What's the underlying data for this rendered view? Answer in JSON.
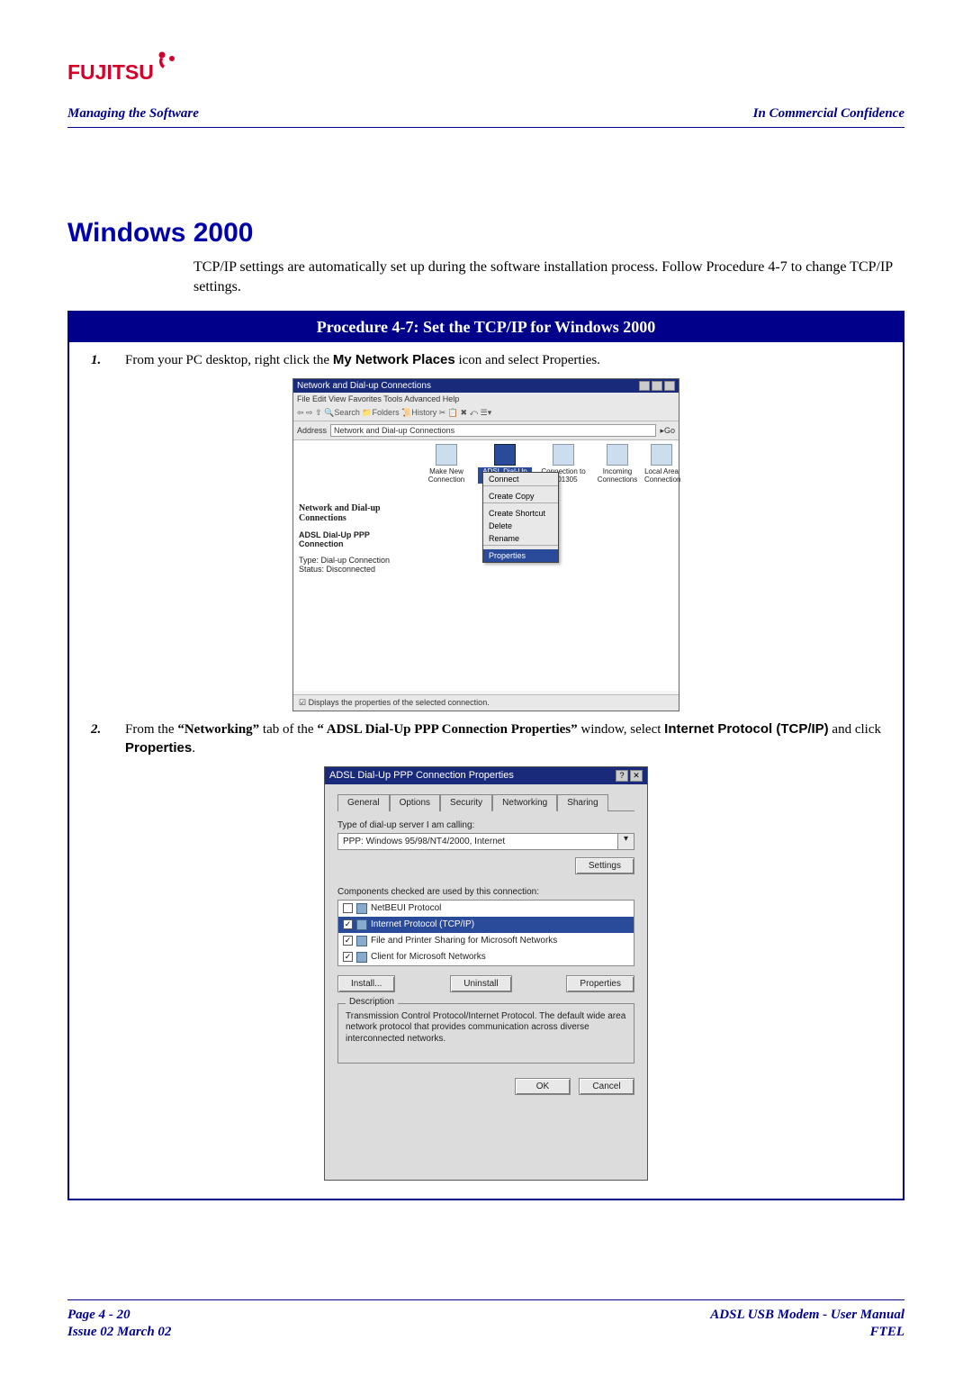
{
  "brand": "FUJITSU",
  "header": {
    "left": "Managing the Software",
    "right": "In Commercial Confidence"
  },
  "section_title": "Windows 2000",
  "intro": "TCP/IP settings are automatically set up during the software installation process. Follow Procedure 4-7 to change TCP/IP settings.",
  "procedure": {
    "title": "Procedure 4-7: Set the TCP/IP for Windows 2000",
    "steps": {
      "s1": {
        "num": "1.",
        "pre": "From your PC desktop, right click the ",
        "bold1": "My Network Places",
        "post": " icon and select Properties."
      },
      "s2": {
        "num": "2.",
        "t1": "From the ",
        "q1": "“Networking”",
        "t2": " tab of the ",
        "q2": "“ ADSL Dial-Up PPP Connection Properties”",
        "t3": " window, select ",
        "b1": "Internet Protocol (TCP/IP)",
        "t4": " and click ",
        "b2": "Properties",
        "t5": "."
      }
    }
  },
  "shot1": {
    "title": "Network and Dial-up Connections",
    "menus": "File  Edit  View  Favorites  Tools  Advanced  Help",
    "toolbar": "⇦  ⇨  ⇧  🔍Search  📁Folders  📜History  ✂ 📋 ✖ ⤺  ☰▾",
    "addr_label": "Address",
    "addr_value": "Network and Dial-up Connections",
    "left_heading": "Network and Dial-up Connections",
    "left_item": "ADSL Dial-Up PPP Connection",
    "left_line1": "Type: Dial-up Connection",
    "left_line2": "Status: Disconnected",
    "icons": {
      "0": "Make New Connection",
      "1": "ADSL Dial-Up PPP Connect",
      "2": "Connection to 3001305",
      "3": "Incoming Connections",
      "4": "Local Area Connection"
    },
    "ctx": {
      "0": "Connect",
      "1": "Create Copy",
      "2": "Create Shortcut",
      "3": "Delete",
      "4": "Rename",
      "5": "Properties"
    },
    "status": "Displays the properties of the selected connection."
  },
  "shot2": {
    "title": "ADSL Dial-Up PPP Connection Properties",
    "help": "?",
    "close": "✕",
    "tabs": {
      "0": "General",
      "1": "Options",
      "2": "Security",
      "3": "Networking",
      "4": "Sharing"
    },
    "type_label": "Type of dial-up server I am calling:",
    "type_value": "PPP: Windows 95/98/NT4/2000, Internet",
    "settings_btn": "Settings",
    "comp_label": "Components checked are used by this connection:",
    "components": {
      "0": "NetBEUI Protocol",
      "1": "Internet Protocol (TCP/IP)",
      "2": "File and Printer Sharing for Microsoft Networks",
      "3": "Client for Microsoft Networks"
    },
    "install": "Install...",
    "uninstall": "Uninstall",
    "properties": "Properties",
    "desc_label": "Description",
    "desc_text": "Transmission Control Protocol/Internet Protocol. The default wide area network protocol that provides communication across diverse interconnected networks.",
    "ok": "OK",
    "cancel": "Cancel"
  },
  "footer": {
    "page": "Page 4 - 20",
    "issue": "Issue 02 March 02",
    "doc": "ADSL USB Modem - User Manual",
    "org": "FTEL"
  }
}
